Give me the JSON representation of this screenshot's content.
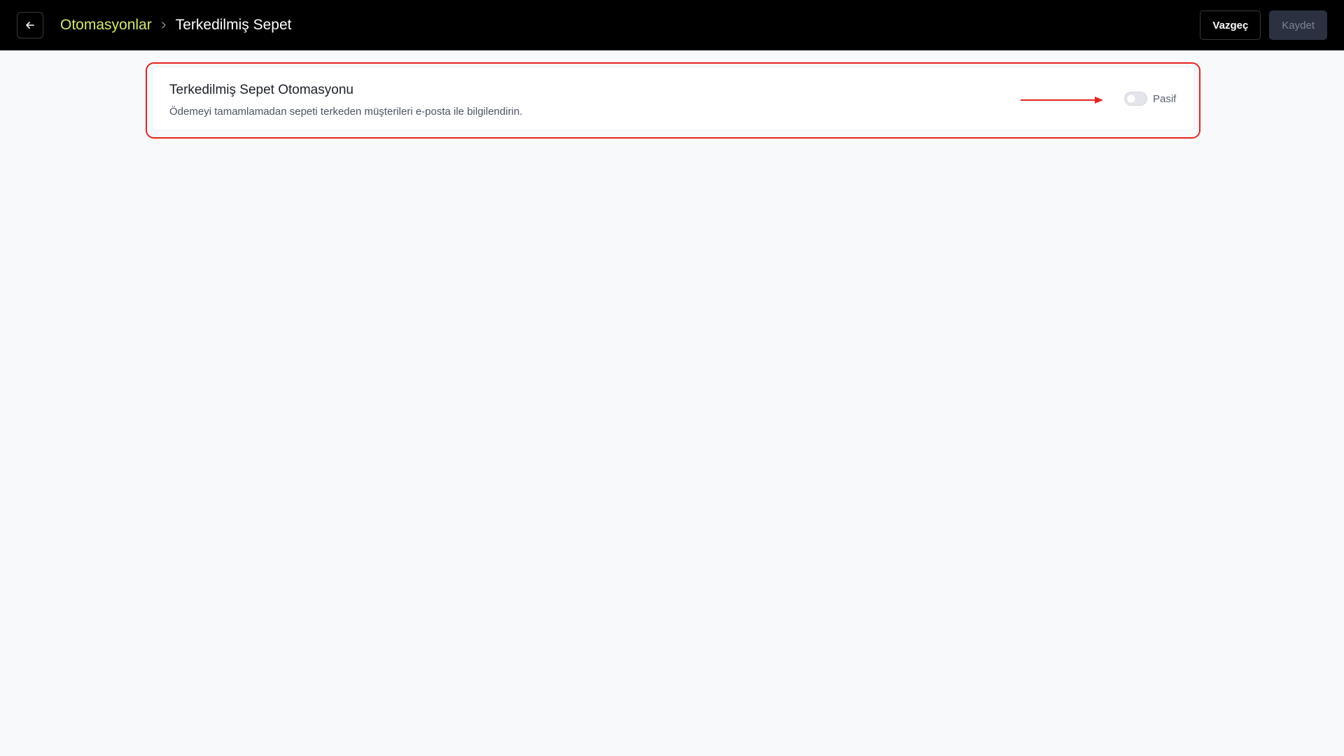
{
  "header": {
    "back_icon": "arrow-left-icon",
    "breadcrumb": {
      "parent": "Otomasyonlar",
      "separator_icon": "chevron-right-icon",
      "current": "Terkedilmiş Sepet"
    },
    "actions": {
      "cancel_label": "Vazgeç",
      "save_label": "Kaydet"
    }
  },
  "card": {
    "title": "Terkedilmiş Sepet Otomasyonu",
    "description": "Ödemeyi tamamlamadan sepeti terkeden müşterileri e-posta ile bilgilendirin.",
    "toggle": {
      "enabled": false,
      "label": "Pasif"
    }
  },
  "annotation": {
    "highlight_color": "#e8231f",
    "arrow_icon": "arrow-right-icon"
  },
  "colors": {
    "breadcrumb_link": "#d6e86a",
    "topbar_bg": "#000000",
    "page_bg": "#f8f9fb"
  }
}
